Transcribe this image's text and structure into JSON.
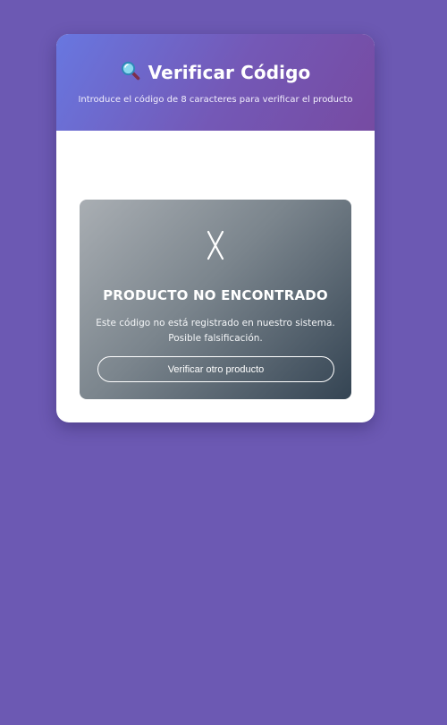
{
  "header": {
    "icon": "magnifier-icon",
    "title": "Verificar Código",
    "subtitle": "Introduce el código de 8 caracteres para verificar el producto"
  },
  "result": {
    "status_icon": "x-mark-icon",
    "title": "PRODUCTO NO ENCONTRADO",
    "message": "Este código no está registrado en nuestro sistema. Posible falsificación.",
    "retry_label": "Verificar otro producto"
  },
  "colors": {
    "page_background": "#6c59b3",
    "header_gradient_start": "#6877e0",
    "header_gradient_end": "#764ba2",
    "result_gradient_start": "#a9aeb3",
    "result_gradient_end": "#344453"
  }
}
